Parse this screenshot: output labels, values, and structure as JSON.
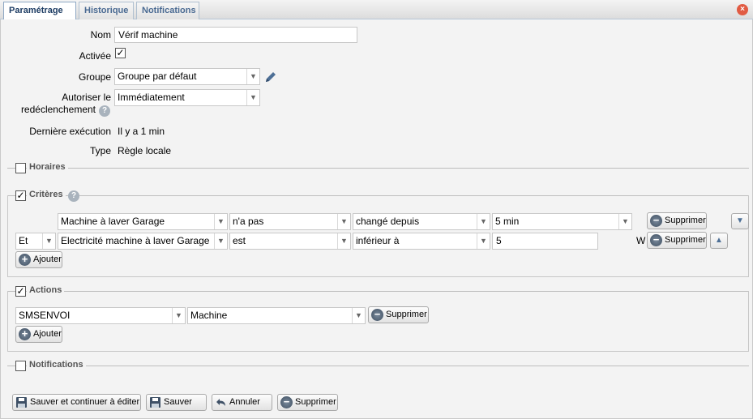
{
  "tabs": [
    {
      "label": "Paramétrage"
    },
    {
      "label": "Historique"
    },
    {
      "label": "Notifications"
    }
  ],
  "form": {
    "nom_label": "Nom",
    "nom_value": "Vérif machine",
    "activee_label": "Activée",
    "groupe_label": "Groupe",
    "groupe_value": "Groupe par défaut",
    "autoriser_label_1": "Autoriser le",
    "autoriser_label_2": "redéclenchement",
    "autoriser_value": "Immédiatement",
    "derniere_label": "Dernière exécution",
    "derniere_value": "Il y a 1 min",
    "type_label": "Type",
    "type_value": "Règle locale"
  },
  "sections": {
    "horaires": "Horaires",
    "criteres": "Critères",
    "actions": "Actions",
    "notifications": "Notifications"
  },
  "criteria": {
    "row1": {
      "device": "Machine à laver Garage",
      "operator": "n'a pas",
      "condition": "changé depuis",
      "value": "5 min",
      "delete": "Supprimer"
    },
    "row2": {
      "logic": "Et",
      "device": "Electricité machine à laver Garage",
      "operator": "est",
      "condition": "inférieur à",
      "value": "5",
      "unit": "W",
      "delete": "Supprimer"
    },
    "add": "Ajouter"
  },
  "actions": {
    "row1": {
      "action": "SMSENVOI",
      "target": "Machine",
      "delete": "Supprimer"
    },
    "add": "Ajouter"
  },
  "footer": {
    "save_continue": "Sauver et continuer à éditer",
    "save": "Sauver",
    "cancel": "Annuler",
    "delete": "Supprimer"
  }
}
